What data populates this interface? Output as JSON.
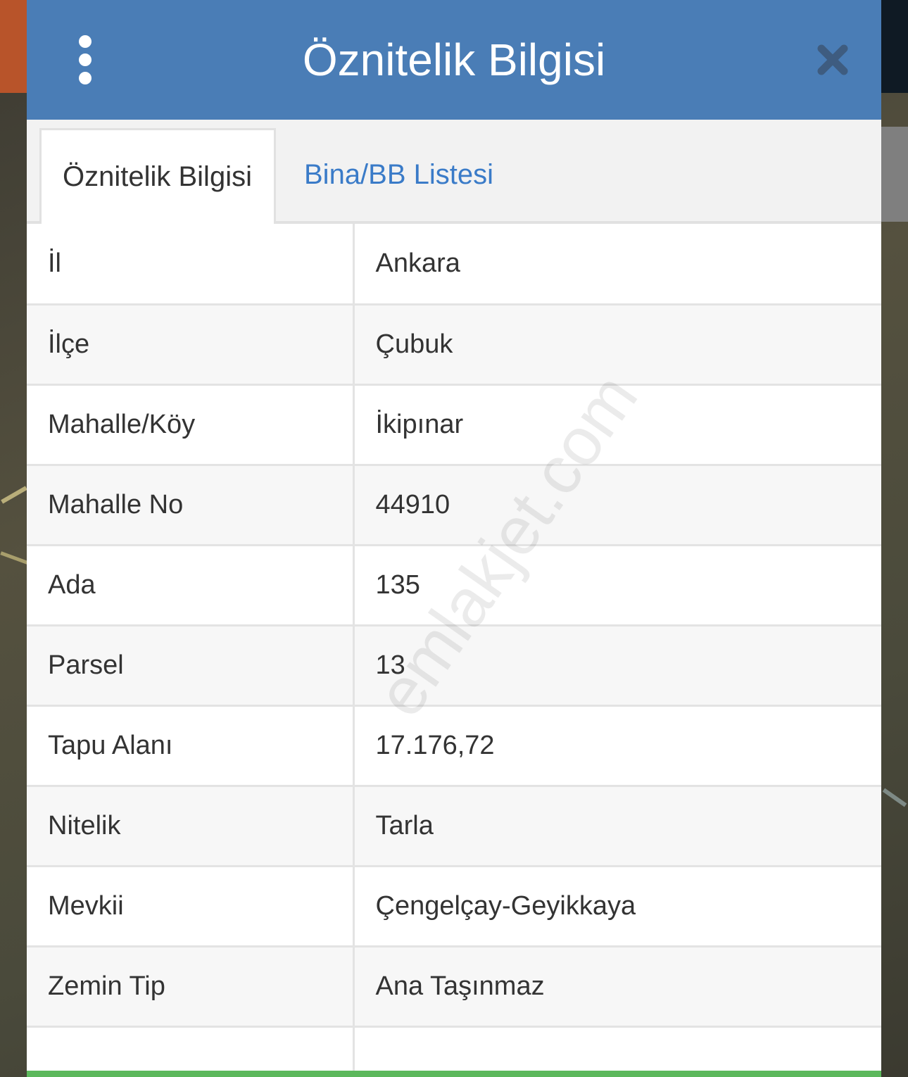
{
  "header": {
    "title": "Öznitelik Bilgisi",
    "menu_icon": "more-vertical-icon",
    "close_icon": "close-icon",
    "color": "#4a7db6"
  },
  "tabs": [
    {
      "label": "Öznitelik Bilgisi",
      "active": true
    },
    {
      "label": "Bina/BB Listesi",
      "active": false
    }
  ],
  "attributes": [
    {
      "key": "İl",
      "value": "Ankara"
    },
    {
      "key": "İlçe",
      "value": "Çubuk"
    },
    {
      "key": "Mahalle/Köy",
      "value": "İkipınar"
    },
    {
      "key": "Mahalle No",
      "value": "44910"
    },
    {
      "key": "Ada",
      "value": "135"
    },
    {
      "key": "Parsel",
      "value": "13"
    },
    {
      "key": "Tapu Alanı",
      "value": "17.176,72"
    },
    {
      "key": "Nitelik",
      "value": "Tarla"
    },
    {
      "key": "Mevkii",
      "value": "Çengelçay-Geyikkaya"
    },
    {
      "key": "Zemin Tip",
      "value": "Ana Taşınmaz"
    },
    {
      "key": "",
      "value": ""
    }
  ],
  "watermark": "emlakjet.com",
  "accent_color": "#5cb85c"
}
